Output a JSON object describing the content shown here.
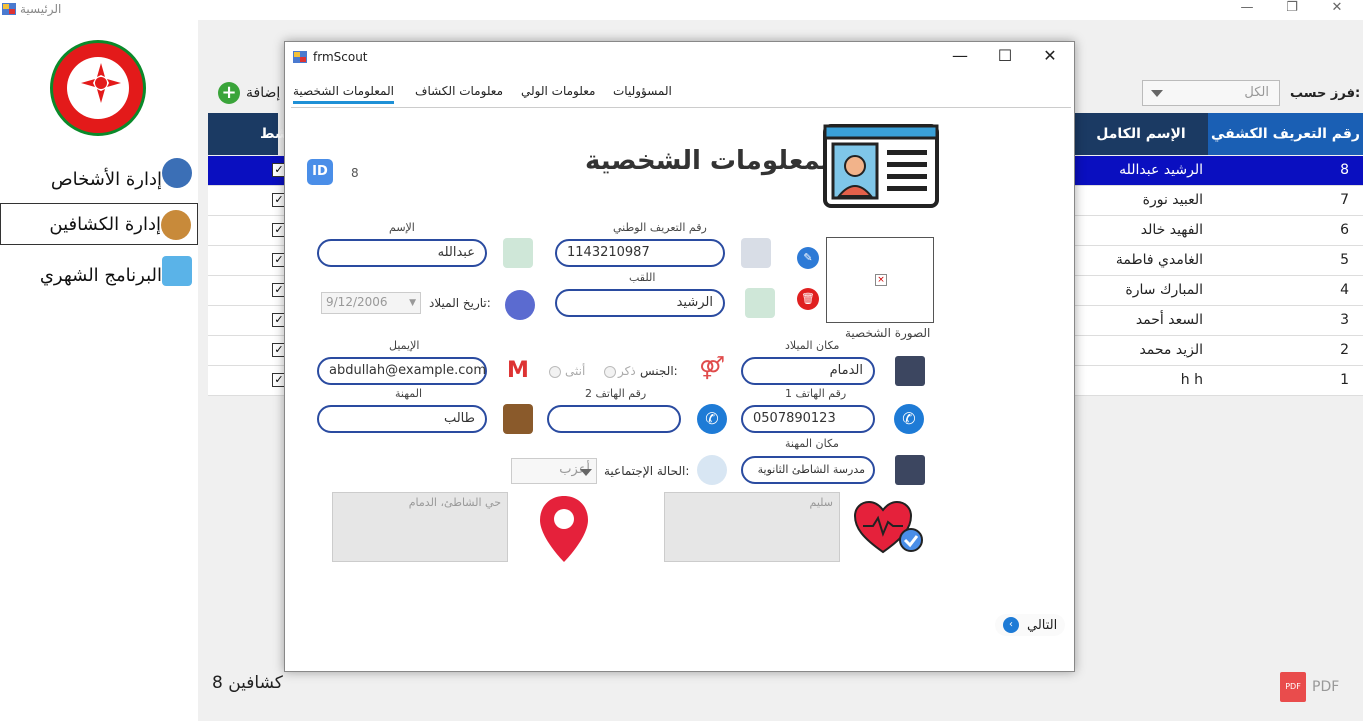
{
  "main_window": {
    "title": "الرئيسية",
    "controls": [
      "—",
      "❐",
      "✕"
    ]
  },
  "sidebar": {
    "items": [
      {
        "label": "إدارة الأشخاص",
        "icon": "people-admin-icon",
        "active": false
      },
      {
        "label": "إدارة الكشافين",
        "icon": "scouts-icon",
        "active": true
      },
      {
        "label": "البرنامج الشهري",
        "icon": "calendar-clock-icon",
        "active": false
      }
    ]
  },
  "toolbar": {
    "add_label": "إضافة",
    "sort_label": "فرز حسب:",
    "sort_value": "الكل"
  },
  "grid": {
    "columns": [
      "رقم التعريف الكشفي",
      "الإسم الكامل",
      "نشط"
    ],
    "rows": [
      {
        "id": "8",
        "name": "الرشيد عبدالله",
        "active": true,
        "selected": true
      },
      {
        "id": "7",
        "name": "العبيد نورة",
        "active": true
      },
      {
        "id": "6",
        "name": "الفهيد خالد",
        "active": true
      },
      {
        "id": "5",
        "name": "الغامدي فاطمة",
        "active": true
      },
      {
        "id": "4",
        "name": "المبارك سارة",
        "active": true
      },
      {
        "id": "3",
        "name": "السعد أحمد",
        "active": true
      },
      {
        "id": "2",
        "name": "الزيد محمد",
        "active": true
      },
      {
        "id": "1",
        "name": "h h",
        "active": true
      }
    ]
  },
  "footer": {
    "count_text": "8 كشافين",
    "pdf_label": "PDF"
  },
  "dialog": {
    "title": "frmScout",
    "controls": [
      "—",
      "☐",
      "✕"
    ],
    "tabs": [
      "المسؤوليات",
      "معلومات الولي",
      "معلومات الكشاف",
      "المعلومات الشخصية"
    ],
    "active_tab": "المعلومات الشخصية",
    "heading": "المعلومات الشخصية",
    "id_value": "8",
    "id_badge": "ID",
    "fields": {
      "national_id_label": "رقم التعريف الوطني",
      "national_id": "1143210987",
      "first_name_label": "الإسم",
      "first_name": "عبدالله",
      "surname_label": "اللقب",
      "surname": "الرشيد",
      "birth_date_label": "تاريخ الميلاد:",
      "birth_date": "9/12/2006",
      "birth_place_label": "مكان الميلاد",
      "birth_place": "الدمام",
      "email_label": "الإيميل",
      "email": "abdullah@example.com",
      "gender_label": "الجنس:",
      "gender_male": "ذكر",
      "gender_female": "أنثى",
      "phone1_label": "رقم الهاتف 1",
      "phone1": "0507890123",
      "phone2_label": "رقم الهاتف 2",
      "phone2": "",
      "job_label": "المهنة",
      "job": "طالب",
      "job_place_label": "مكان المهنة",
      "job_place": "مدرسة الشاطئ الثانوية",
      "marital_label": "الحالة الإجتماعية:",
      "marital_value": "أعزب",
      "address": "حي الشاطئ، الدمام",
      "health": "سليم",
      "photo_label": "الصورة الشخصية"
    },
    "next_label": "التالي"
  }
}
